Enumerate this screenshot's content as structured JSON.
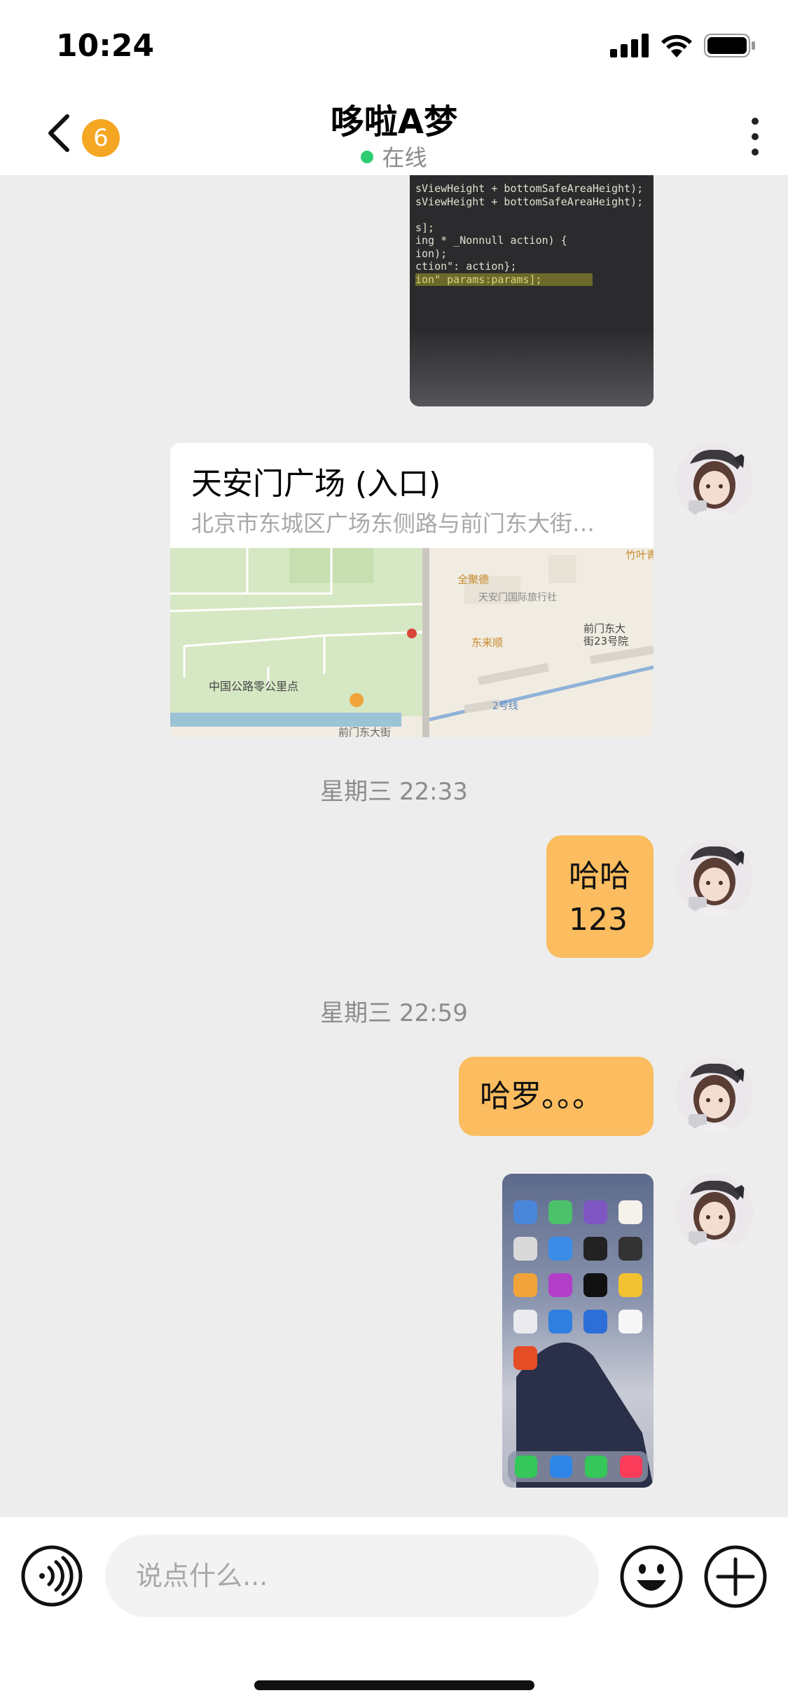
{
  "status_bar": {
    "time": "10:24",
    "icons": [
      "signal-icon",
      "wifi-icon",
      "battery-icon"
    ]
  },
  "header": {
    "badge_count": "6",
    "title": "哆啦A梦",
    "status": "在线",
    "icons": [
      "back-chevron-icon",
      "more-vertical-icon"
    ]
  },
  "messages": {
    "location": {
      "title": "天安门广场 (入口)",
      "address": "北京市东城区广场东侧路与前门东大街…",
      "map_labels": {
        "quanjude": "全聚德",
        "travel_agency": "天安门国际旅行社",
        "donglaishun": "东来顺",
        "qianmen_23": "前门东大\n街23号院",
        "zhuye": "竹叶青",
        "zero_point": "中国公路零公里点",
        "line2": "2号线",
        "street": "前门东大街"
      }
    },
    "timestamp_1": "星期三 22:33",
    "text_1": "哈哈\n123",
    "timestamp_2": "星期三 22:59",
    "text_2": "哈罗。。。"
  },
  "input_bar": {
    "placeholder": "说点什么...",
    "icons": [
      "voice-icon",
      "emoji-icon",
      "plus-icon"
    ]
  },
  "colors": {
    "bubble": "#fbbd5f",
    "badge": "#f5a623",
    "online": "#2ecc71",
    "background": "#ededed"
  }
}
